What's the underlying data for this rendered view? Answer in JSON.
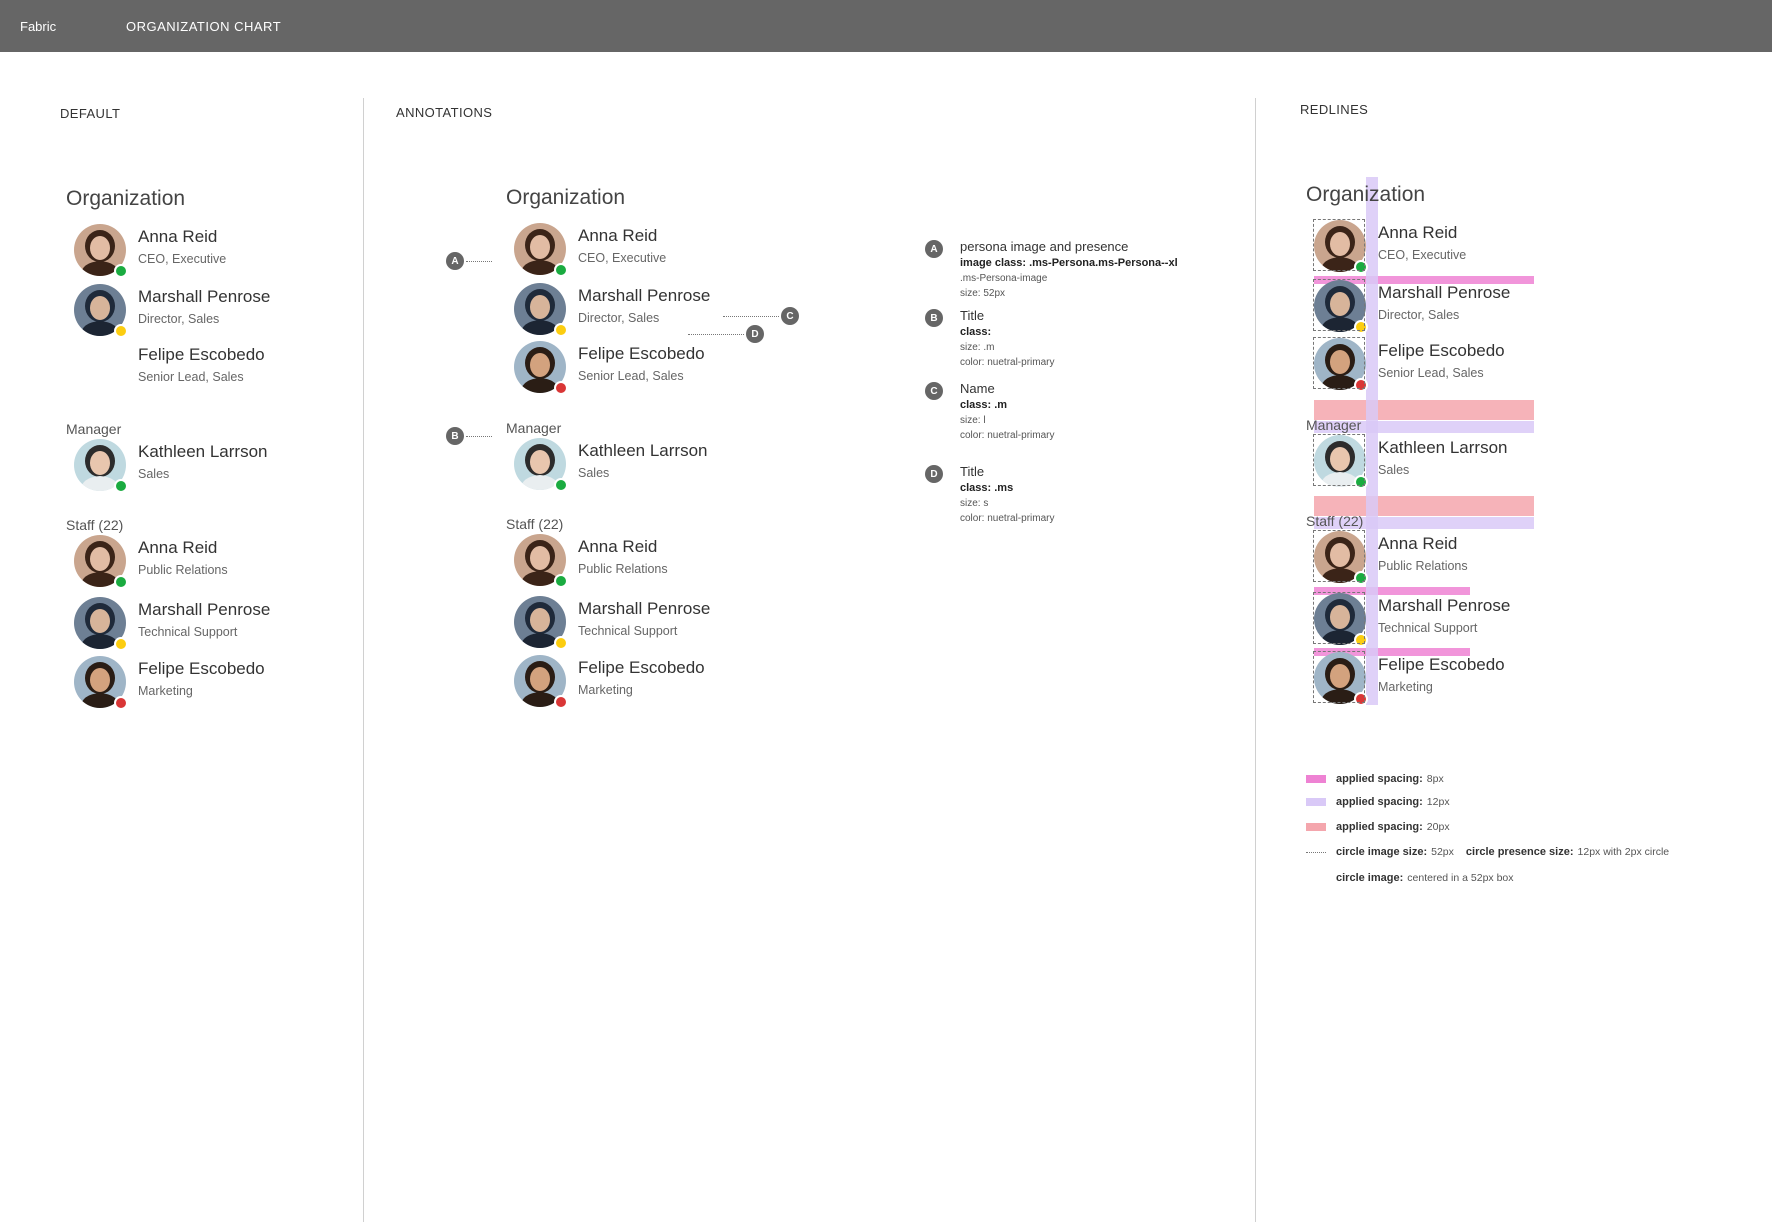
{
  "topbar": {
    "brand": "Fabric",
    "title": "ORGANIZATION CHART"
  },
  "columns": {
    "default": "DEFAULT",
    "annotations": "ANNOTATIONS",
    "redlines": "REDLINES"
  },
  "org_heading": "Organization",
  "colors": {
    "topbar": "#666666",
    "presence_available": "#1aab40",
    "presence_away": "#fccd10",
    "presence_busy": "#d93636",
    "spacing_8": "#ee82d3",
    "spacing_12": "#d9c9f7",
    "spacing_20": "#f4a6ad"
  },
  "chain": [
    {
      "name": "Anna Reid",
      "title": "CEO, Executive",
      "presence": "available",
      "avatar": "woman-curly-icon"
    },
    {
      "name": "Marshall Penrose",
      "title": "Director, Sales",
      "presence": "away",
      "avatar": "man-suit-icon"
    },
    {
      "name": "Felipe Escobedo",
      "title": "Senior Lead, Sales",
      "presence": "busy",
      "avatar": "man-smile-icon"
    }
  ],
  "manager_label": "Manager",
  "manager": {
    "name": "Kathleen Larrson",
    "title": "Sales",
    "presence": "available",
    "avatar": "woman-scarf-icon"
  },
  "staff_label": "Staff (22)",
  "staff": [
    {
      "name": "Anna Reid",
      "title": "Public Relations",
      "presence": "available",
      "avatar": "woman-curly-icon"
    },
    {
      "name": "Marshall Penrose",
      "title": "Technical Support",
      "presence": "away",
      "avatar": "man-suit-icon"
    },
    {
      "name": "Felipe Escobedo",
      "title": "Marketing",
      "presence": "busy",
      "avatar": "man-smile-icon"
    }
  ],
  "annotation_markers": {
    "a": "A",
    "b": "B",
    "c": "C",
    "d": "D"
  },
  "notes": [
    {
      "marker": "A",
      "head": "persona image and presence",
      "bold": "image class: .ms-Persona.ms-Persona--xl",
      "lines": [
        ".ms-Persona-image",
        "size: 52px"
      ]
    },
    {
      "marker": "B",
      "head": "Title",
      "bold": "class:",
      "lines": [
        "size:  .m",
        "color: nuetral-primary"
      ]
    },
    {
      "marker": "C",
      "head": "Name",
      "bold": "class: .m",
      "lines": [
        "size: l",
        "color: nuetral-primary"
      ]
    },
    {
      "marker": "D",
      "head": "Title",
      "bold": "class: .ms",
      "lines": [
        "size: s",
        "color: nuetral-primary"
      ]
    }
  ],
  "legend": {
    "spacing_label": "applied spacing:",
    "spacing_8": "8px",
    "spacing_12": "12px",
    "spacing_20": "20px",
    "circle_image_size_label": "circle image size:",
    "circle_image_size": "52px",
    "circle_presence_size_label": "circle presence size:",
    "circle_presence_size": "12px with 2px circle",
    "circle_image_label": "circle image:",
    "circle_image": "centered in a 52px box"
  }
}
